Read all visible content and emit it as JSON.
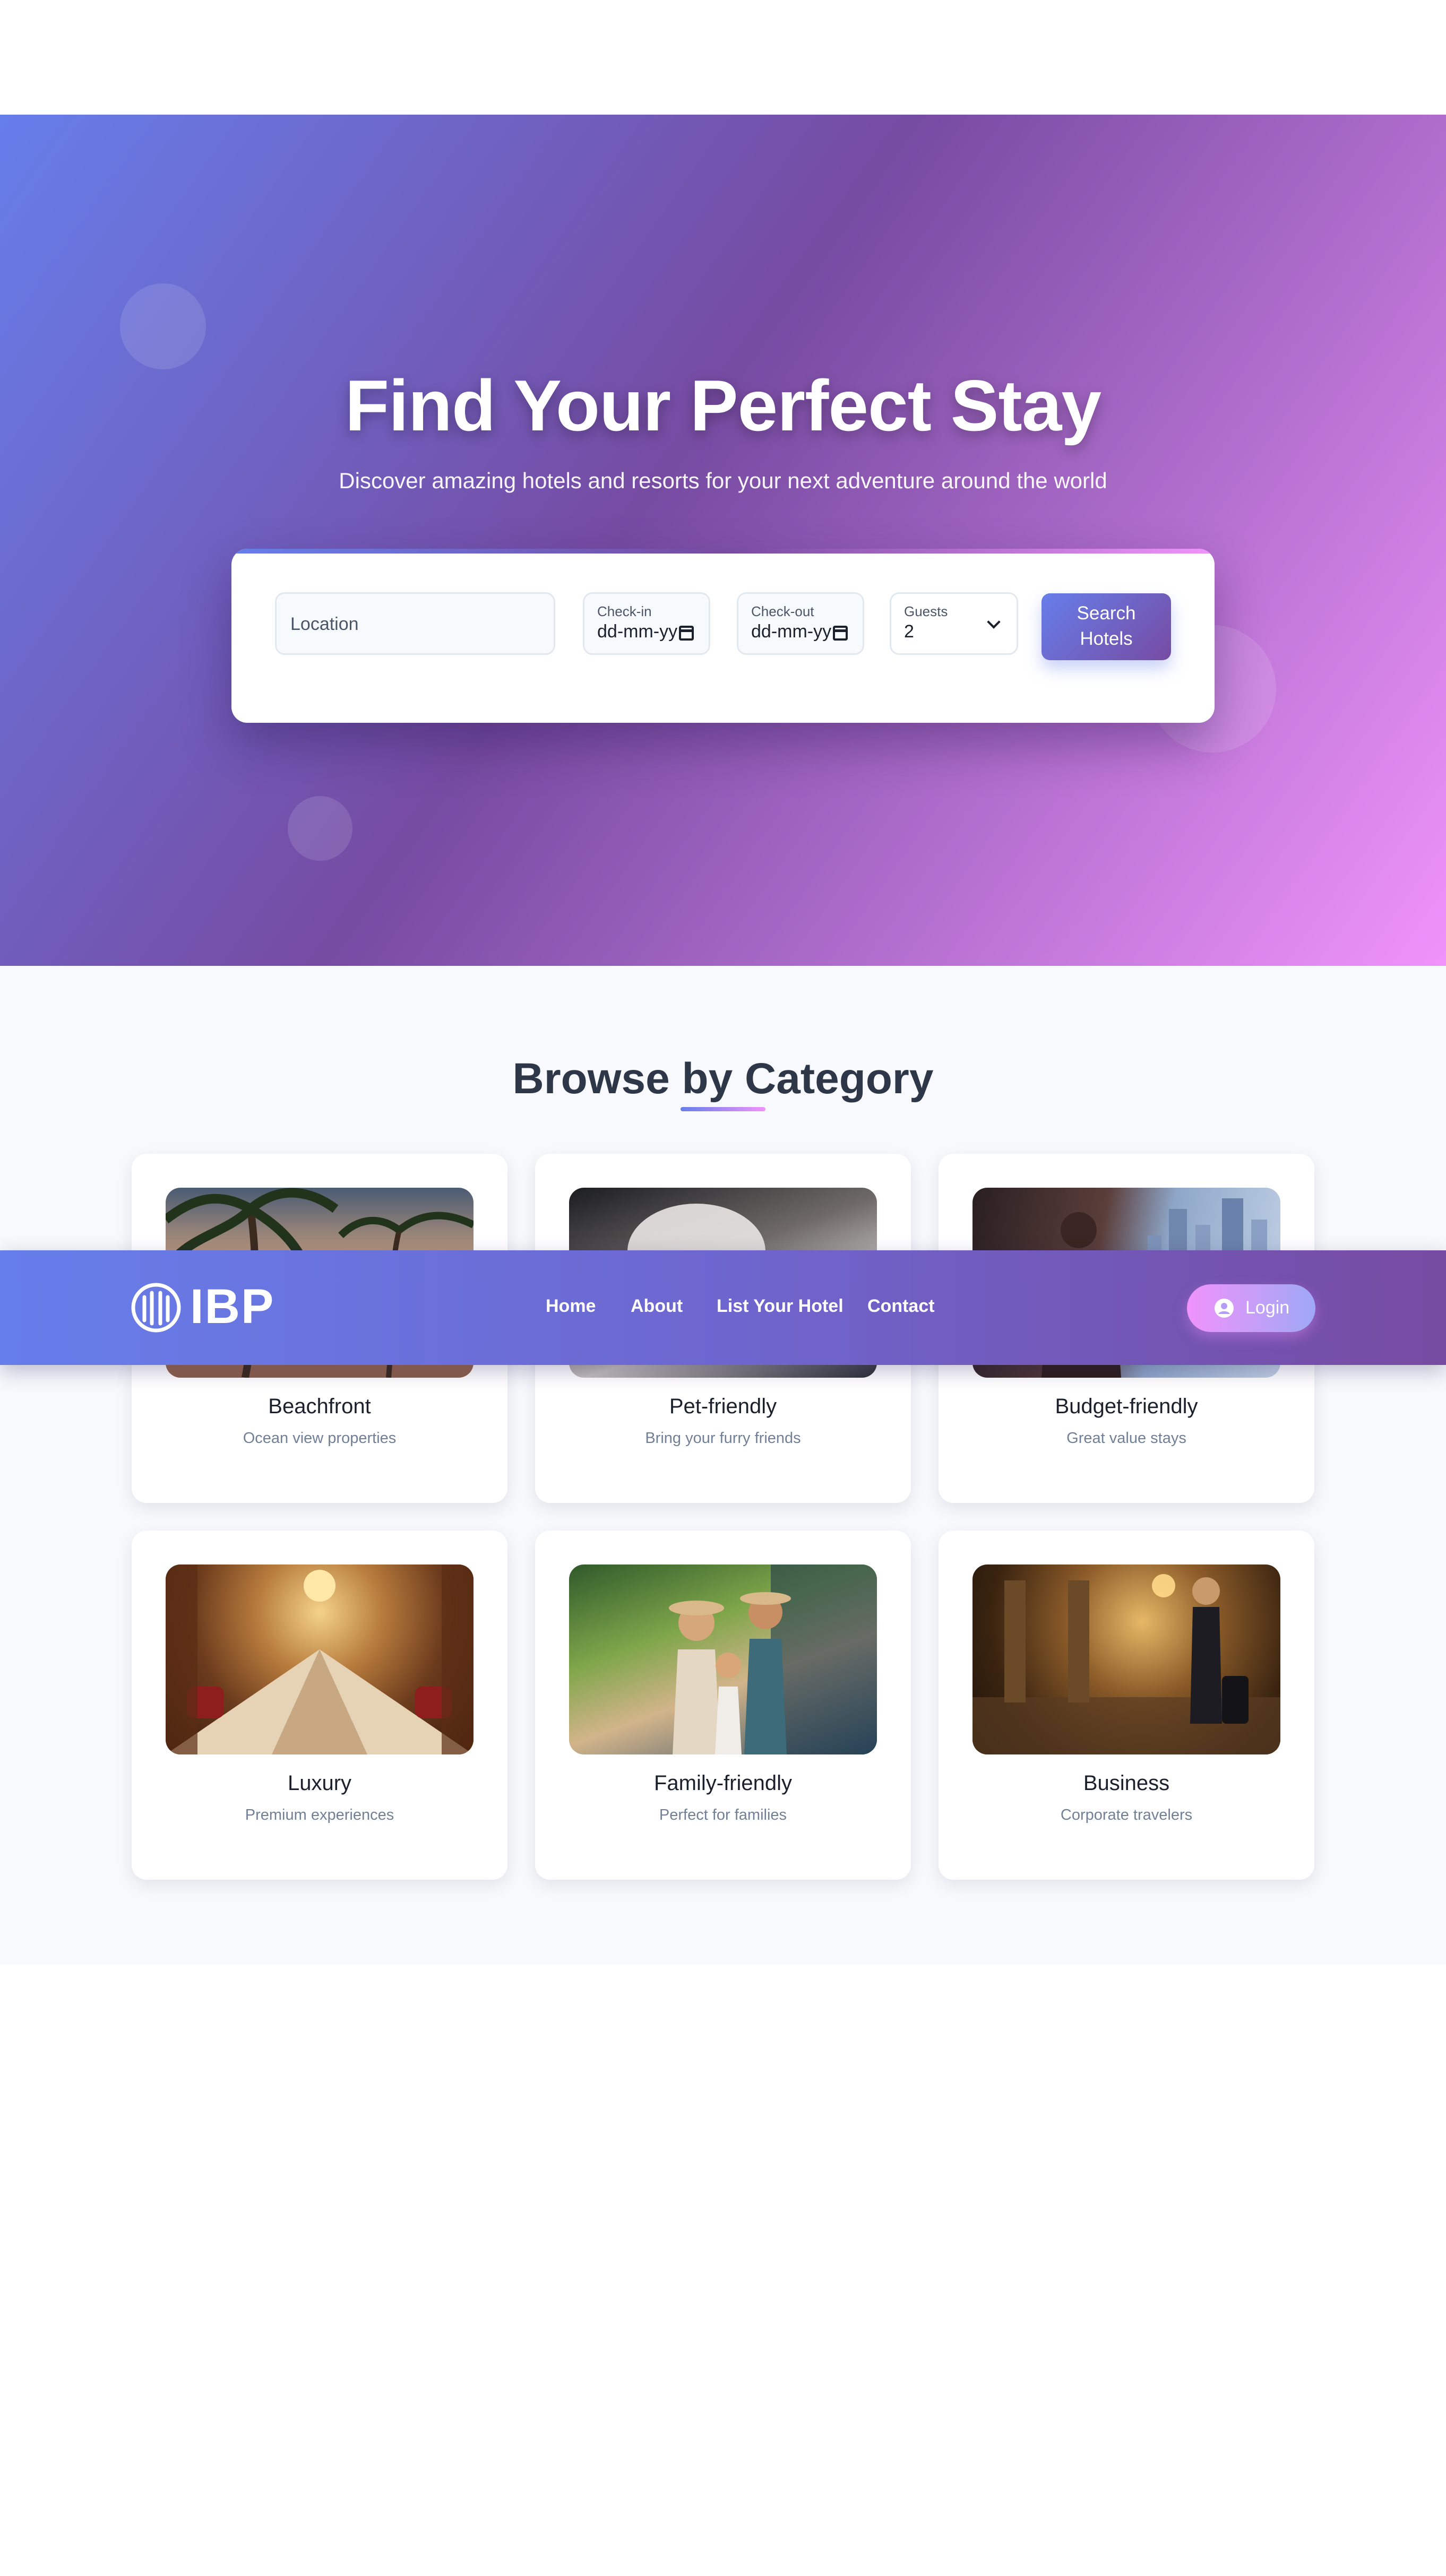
{
  "hero": {
    "title": "Find Your Perfect Stay",
    "subtitle": "Discover amazing hotels and resorts for your next adventure around the world"
  },
  "search": {
    "location_placeholder": "Location",
    "checkin_label": "Check-in",
    "checkin_value": "dd-mm-yy",
    "checkout_label": "Check-out",
    "checkout_value": "dd-mm-yy",
    "guests_label": "Guests",
    "guests_value": "2",
    "button_line1": "Search",
    "button_line2": "Hotels"
  },
  "categories": {
    "title": "Browse by Category",
    "items": [
      {
        "name": "Beachfront",
        "description": "Ocean view properties"
      },
      {
        "name": "Pet-friendly",
        "description": "Bring your furry friends"
      },
      {
        "name": "Budget-friendly",
        "description": "Great value stays"
      },
      {
        "name": "Luxury",
        "description": "Premium experiences"
      },
      {
        "name": "Family-friendly",
        "description": "Perfect for families"
      },
      {
        "name": "Business",
        "description": "Corporate travelers"
      }
    ]
  },
  "nav": {
    "logo": "IBP",
    "links": [
      "Home",
      "About",
      "List Your Hotel",
      "Contact"
    ],
    "login": "Login"
  },
  "colors": {
    "gradient_start": "#667eea",
    "gradient_mid": "#764ba2",
    "gradient_end": "#f093fb",
    "heading": "#2d3748",
    "muted": "#718096"
  }
}
